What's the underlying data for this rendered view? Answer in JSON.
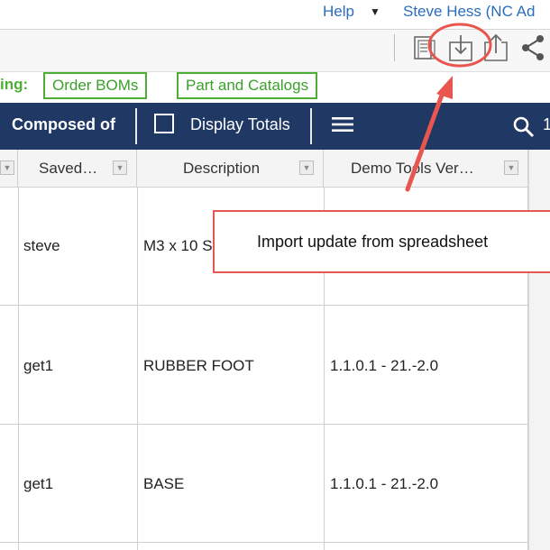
{
  "header": {
    "help_label": "Help",
    "user_label": "Steve Hess (NC Ad"
  },
  "toolbar": {
    "icons": [
      "document-icon",
      "import-icon",
      "export-icon",
      "share-icon"
    ]
  },
  "bom_bar": {
    "label": "ing:",
    "buttons": [
      "Order BOMs",
      "Part and Catalogs"
    ]
  },
  "nav": {
    "composed_of": "Composed of",
    "display_totals": "Display Totals",
    "more": "1"
  },
  "grid": {
    "columns": [
      "Saved…",
      "Description",
      "Demo Tools Ver…"
    ],
    "rows": [
      {
        "saved": "steve",
        "description": "M3 x 10 S",
        "version": ""
      },
      {
        "saved": "get1",
        "description": "RUBBER FOOT",
        "version": "1.1.0.1 - 21.-2.0"
      },
      {
        "saved": "get1",
        "description": "BASE",
        "version": "1.1.0.1 - 21.-2.0"
      }
    ]
  },
  "callout": {
    "text": "Import update from spreadsheet"
  },
  "colors": {
    "navy": "#1f3864",
    "link": "#2a6ebb",
    "green": "#4caf33",
    "annotation_red": "#e8564f"
  }
}
